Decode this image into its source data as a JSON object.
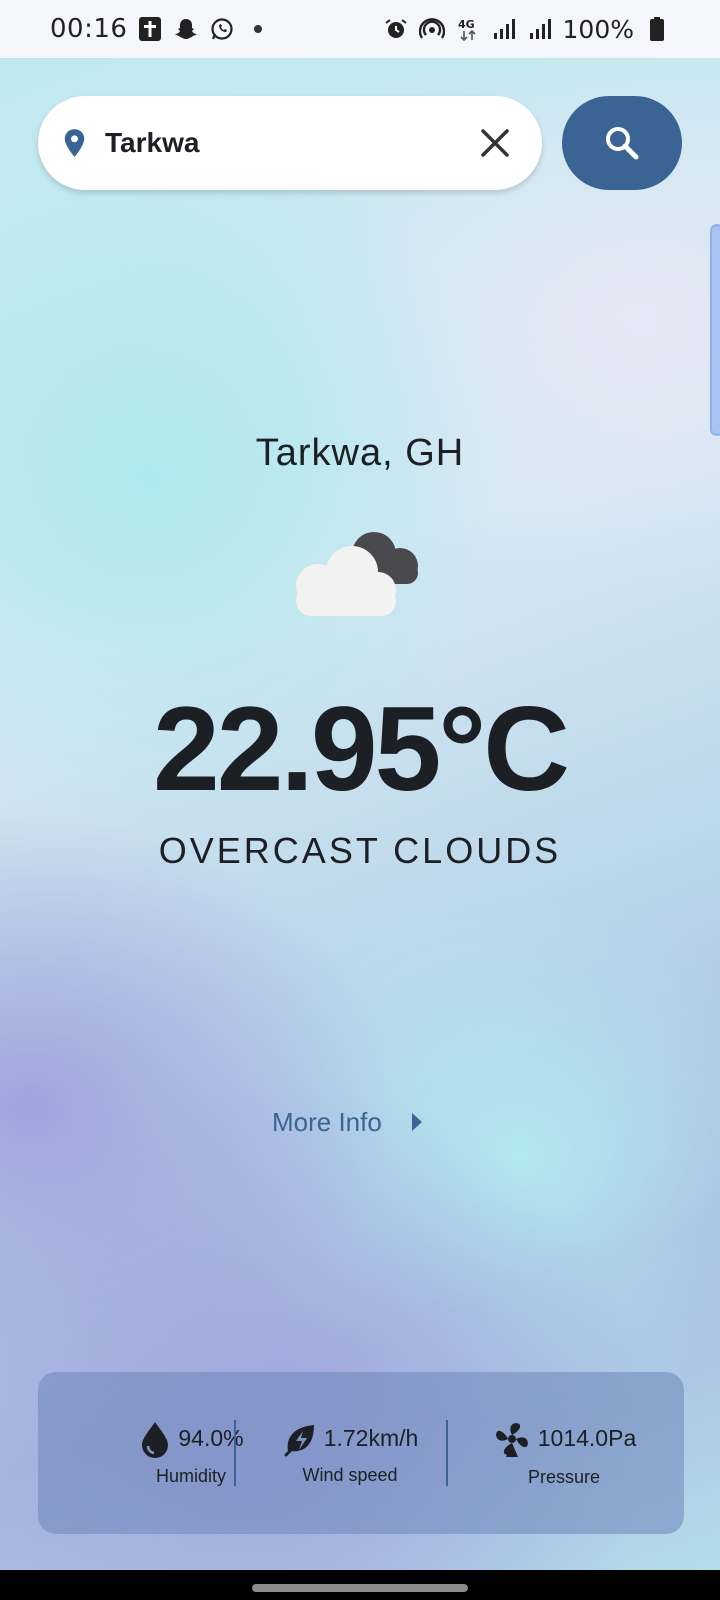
{
  "status_bar": {
    "time": "00:16",
    "battery": "100%",
    "left_icons": [
      "bible-icon",
      "snapchat-icon",
      "whatsapp-icon",
      "dot-icon"
    ],
    "right_icons": [
      "alarm-icon",
      "hotspot-icon",
      "4g-icon",
      "signal-icon",
      "signal-icon",
      "battery-icon"
    ]
  },
  "search": {
    "value": "Tarkwa",
    "placeholder": ""
  },
  "weather": {
    "city": "Tarkwa, GH",
    "temperature": "22.95°C",
    "condition": "OVERCAST CLOUDS",
    "icon": "overcast-clouds-icon"
  },
  "more_info": {
    "label": "More Info"
  },
  "stats": {
    "humidity": {
      "value": "94.0%",
      "label": "Humidity"
    },
    "wind": {
      "value": "1.72km/h",
      "label": "Wind speed"
    },
    "pressure": {
      "value": "1014.0Pa",
      "label": "Pressure"
    }
  },
  "colors": {
    "accent": "#3a6494",
    "text": "#1c1f24",
    "card": "#7d93c4"
  }
}
